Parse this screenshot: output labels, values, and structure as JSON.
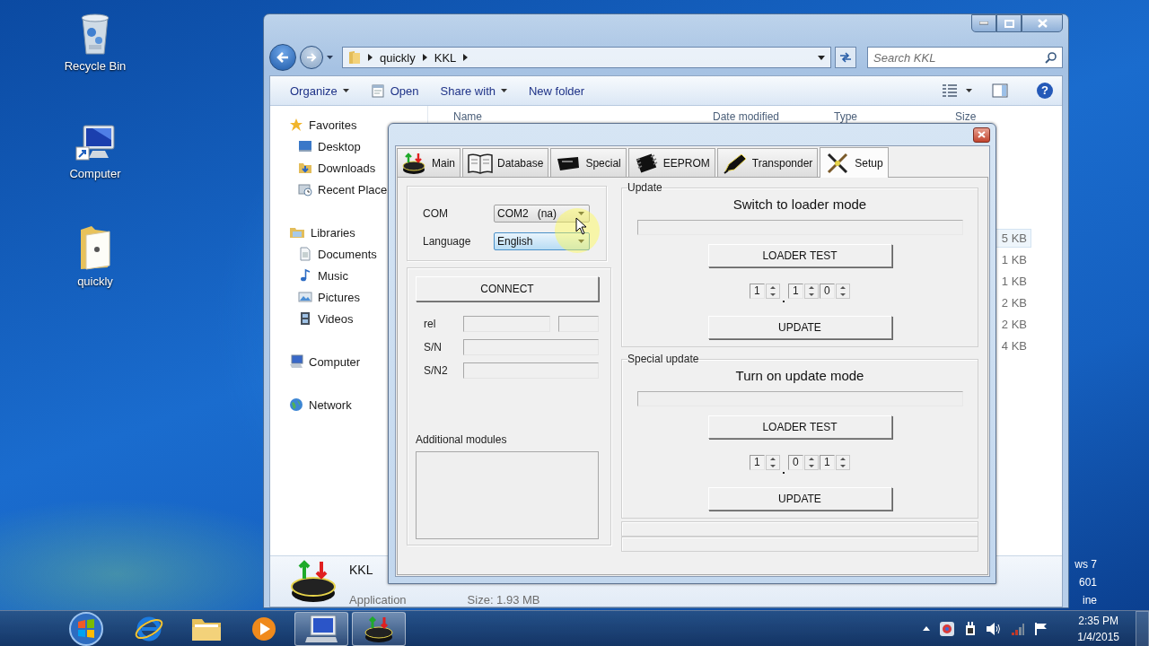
{
  "desktop": {
    "icons": [
      {
        "label": "Recycle Bin",
        "kind": "bin"
      },
      {
        "label": "Computer",
        "kind": "computer"
      },
      {
        "label": "quickly",
        "kind": "folder"
      }
    ],
    "corner_text": [
      "ws 7",
      "601",
      "ine"
    ]
  },
  "explorer": {
    "breadcrumb": [
      "quickly",
      "KKL"
    ],
    "search": {
      "placeholder": "Search KKL"
    },
    "toolbar": [
      {
        "label": "Organize",
        "kind": "menu"
      },
      {
        "label": "Open",
        "kind": "open"
      },
      {
        "label": "Share with",
        "kind": "menu"
      },
      {
        "label": "New folder",
        "kind": "plain"
      }
    ],
    "help": "?",
    "nav": [
      {
        "label": "Favorites",
        "kind": "star",
        "children": [
          {
            "label": "Desktop",
            "kind": "desktop"
          },
          {
            "label": "Downloads",
            "kind": "downloads"
          },
          {
            "label": "Recent Place",
            "kind": "recent"
          }
        ]
      },
      {
        "label": "Libraries",
        "kind": "libraries",
        "children": [
          {
            "label": "Documents",
            "kind": "documents"
          },
          {
            "label": "Music",
            "kind": "music"
          },
          {
            "label": "Pictures",
            "kind": "pictures"
          },
          {
            "label": "Videos",
            "kind": "videos"
          }
        ]
      },
      {
        "label": "Computer",
        "kind": "computer"
      },
      {
        "label": "Network",
        "kind": "network"
      }
    ],
    "columns": [
      "Name",
      "Date modified",
      "Type",
      "Size"
    ],
    "rows": [
      {
        "size": "5 KB",
        "selected": true
      },
      {
        "size": "1 KB",
        "selected": false
      },
      {
        "size": "1 KB",
        "selected": false
      },
      {
        "size": "2 KB",
        "selected": false
      },
      {
        "size": "2 KB",
        "selected": false
      },
      {
        "size": "4 KB",
        "selected": false
      }
    ],
    "details": {
      "name": "KKL",
      "type": "Application",
      "size": "Size: 1.93 MB"
    }
  },
  "kkl": {
    "tabs": [
      {
        "label": "Main",
        "kind": "main",
        "selected": false
      },
      {
        "label": "Database",
        "kind": "book",
        "selected": false
      },
      {
        "label": "Special",
        "kind": "card",
        "selected": false
      },
      {
        "label": "EEPROM",
        "kind": "chip",
        "selected": false
      },
      {
        "label": "Transponder",
        "kind": "pen",
        "selected": false
      },
      {
        "label": "Setup",
        "kind": "tools",
        "selected": true
      }
    ],
    "com": {
      "label": "COM",
      "value": "COM2   (na)",
      "focused": false
    },
    "language": {
      "label": "Language",
      "value": "English",
      "focused": true
    },
    "connect": "CONNECT",
    "info": [
      {
        "label": "rel",
        "kind": "split"
      },
      {
        "label": "S/N",
        "kind": "single"
      },
      {
        "label": "S/N2",
        "kind": "single"
      }
    ],
    "modules_label": "Additional modules",
    "groups": [
      {
        "title": "Update",
        "heading": "Switch to loader mode",
        "level": 0,
        "test": "LOADER TEST",
        "version": [
          "1",
          "1",
          "0"
        ],
        "update": "UPDATE"
      },
      {
        "title": "Special update",
        "heading": "Turn on update mode",
        "level": 0,
        "test": "LOADER TEST",
        "version": [
          "1",
          "0",
          "1"
        ],
        "update": "UPDATE"
      }
    ]
  },
  "taskbar": {
    "apps": [
      {
        "kind": "ie",
        "active": false
      },
      {
        "kind": "folder",
        "active": false
      },
      {
        "kind": "media",
        "active": false
      },
      {
        "kind": "monitor",
        "active": true
      },
      {
        "kind": "kkl",
        "active": true
      }
    ],
    "time": "2:35 PM",
    "date": "1/4/2015"
  }
}
